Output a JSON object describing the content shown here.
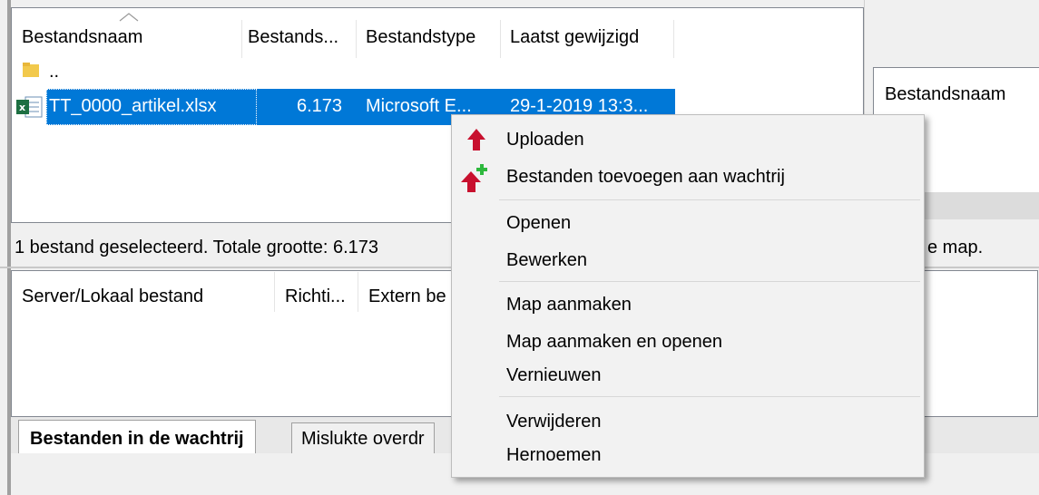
{
  "local_list": {
    "columns": [
      "Bestandsnaam",
      "Bestands...",
      "Bestandstype",
      "Laatst gewijzigd"
    ],
    "parent_row": "..",
    "file_row": {
      "name": "TT_0000_artikel.xlsx",
      "size": "6.173",
      "type": "Microsoft E...",
      "modified": "29-1-2019 13:3..."
    },
    "status": "1 bestand geselecteerd. Totale grootte: 6.173"
  },
  "remote_list": {
    "column": "Bestandsnaam",
    "status_fragment": "e map."
  },
  "queue": {
    "columns": [
      "Server/Lokaal bestand",
      "Richti...",
      "Extern be"
    ],
    "tabs": [
      "Bestanden in de wachtrij",
      "Mislukte overdr"
    ]
  },
  "context_menu": {
    "items": [
      {
        "label": "Uploaden",
        "icon": "upload-arrow-icon"
      },
      {
        "label": "Bestanden toevoegen aan wachtrij",
        "icon": "add-to-queue-icon"
      },
      {
        "label": "Openen"
      },
      {
        "label": "Bewerken"
      },
      {
        "label": "Map aanmaken"
      },
      {
        "label": "Map aanmaken en openen"
      },
      {
        "label": "Vernieuwen"
      },
      {
        "label": "Verwijderen"
      },
      {
        "label": "Hernoemen"
      }
    ]
  },
  "colors": {
    "selection": "#0078d7",
    "upload_arrow": "#c8102e",
    "plus": "#2db83d",
    "excel": "#1d6f42"
  }
}
